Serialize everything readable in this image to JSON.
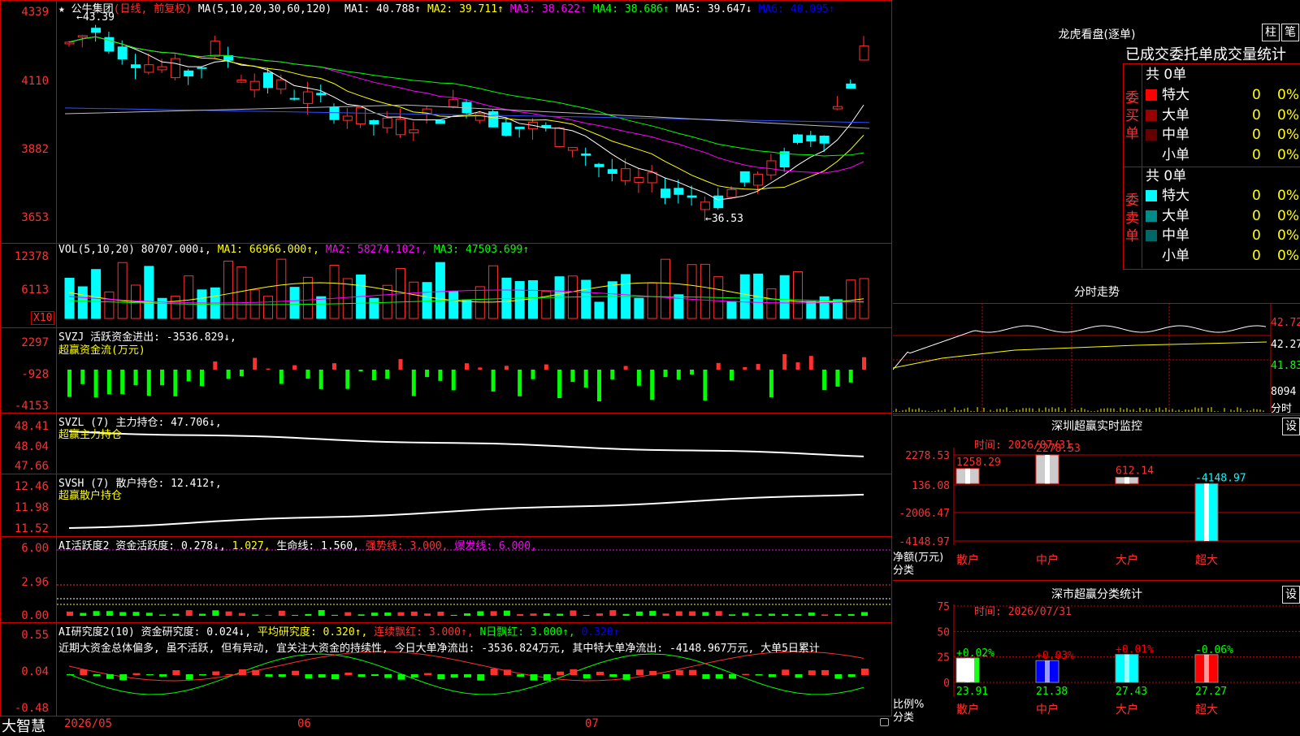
{
  "stock": {
    "star": "★",
    "name": "公牛集团",
    "period": "(日线, 前复权)"
  },
  "main_legend": {
    "ma_spec": "MA(5,10,20,30,60,120)",
    "items": [
      {
        "label": "MA1: 40.788↑",
        "color": "#ffffff"
      },
      {
        "label": "MA2: 39.711↑",
        "color": "#ffff00"
      },
      {
        "label": "MA3: 38.622↑",
        "color": "#ff00ff"
      },
      {
        "label": "MA4: 38.686↑",
        "color": "#00ff00"
      },
      {
        "label": "MA5: 39.647↓",
        "color": "#ffffff"
      },
      {
        "label": "MA6: 40.095↑",
        "color": "#0000ff"
      }
    ],
    "high_marker": "←43.39",
    "low_marker": "←36.53"
  },
  "main_axis": {
    "labels": [
      "4339",
      "4110",
      "3882",
      "3653"
    ]
  },
  "vol": {
    "legend": "VOL(5,10,20)",
    "value": "80707.000↓",
    "ma1": "MA1: 66966.000↑",
    "ma2": "MA2: 58274.102↑",
    "ma3": "MA3: 47503.699↑",
    "axis": [
      "12378",
      "6113"
    ],
    "unit": "X10"
  },
  "svzj": {
    "legend": "SVZJ  活跃资金进出: -3536.829↓,",
    "sub": "超赢资金流(万元)",
    "axis": [
      "2297",
      "-928",
      "-4153"
    ]
  },
  "svzl": {
    "legend": "SVZL (7) 主力持仓: 47.706↓,",
    "sub": "超赢主力持仓",
    "axis": [
      "48.41",
      "48.04",
      "47.66"
    ]
  },
  "svsh": {
    "legend": "SVSH (7) 散户持仓: 12.412↑,",
    "sub": "超赢散户持仓",
    "axis": [
      "12.46",
      "11.98",
      "11.52"
    ]
  },
  "ai_active": {
    "legend_a": "AI活跃度2 资金活跃度: 0.278↓,",
    "legend_b": "1.027,",
    "legend_c": "生命线: 1.560,",
    "legend_d": "强势线: 3.000,",
    "legend_e": "爆发线: 6.000,",
    "axis": [
      "6.00",
      "2.96",
      "0.00"
    ]
  },
  "ai_research": {
    "legend_a": "AI研究度2(10) 资金研究度: 0.024↓,",
    "legend_b": "平均研究度: 0.320↑,",
    "legend_c": "连续飘红: 3.000↑,",
    "legend_d": "N日飘红: 3.000↑,",
    "legend_e": "0.320↑",
    "comment": "近期大资金总体偏多, 虽不活跃, 但有异动, 宜关注大资金的持续性, 今日大单净流出: -3536.824万元, 其中特大单净流出: -4148.967万元, 大单5日累计",
    "axis": [
      "0.55",
      "0.04",
      "-0.48"
    ]
  },
  "x_axis": {
    "labels": [
      "2026/05",
      "06",
      "07"
    ]
  },
  "brand": "大智慧",
  "lhb": {
    "title": "龙虎看盘(逐单)",
    "btn_a": "柱",
    "btn_b": "笔",
    "header": "已成交委托单成交量统计",
    "buy_label": "委买单",
    "sell_label": "委卖单",
    "buy_total": "共 0单",
    "sell_total": "共 0单",
    "buy_rows": [
      {
        "name": "特大",
        "count": "0",
        "pct": "0%",
        "color": "#ff0000"
      },
      {
        "name": "大单",
        "count": "0",
        "pct": "0%",
        "color": "#990000"
      },
      {
        "name": "中单",
        "count": "0",
        "pct": "0%",
        "color": "#660000"
      },
      {
        "name": "小单",
        "count": "0",
        "pct": "0%",
        "color": "#000000"
      }
    ],
    "sell_rows": [
      {
        "name": "特大",
        "count": "0",
        "pct": "0%",
        "color": "#00ffff"
      },
      {
        "name": "大单",
        "count": "0",
        "pct": "0%",
        "color": "#008b8b"
      },
      {
        "name": "中单",
        "count": "0",
        "pct": "0%",
        "color": "#006666"
      },
      {
        "name": "小单",
        "count": "0",
        "pct": "0%",
        "color": "#000000"
      }
    ]
  },
  "intraday": {
    "title": "分时走势",
    "axis_right": [
      "42.72",
      "42.27",
      "41.83",
      "8094"
    ],
    "vol_caption": "分时"
  },
  "sz_monitor": {
    "title": "深圳超赢实时监控",
    "btn": "设",
    "time": "时间: 2026/07/31",
    "axis": [
      "2278.53",
      "136.08",
      "-2006.47",
      "-4148.97"
    ],
    "y_caption_a": "净额(万元)",
    "y_caption_b": "分类",
    "bars": [
      {
        "cat": "散户",
        "value": 1258.29,
        "label": "1258.29"
      },
      {
        "cat": "中户",
        "value": 2278.53,
        "label": "2278.53"
      },
      {
        "cat": "大户",
        "value": 612.14,
        "label": "612.14"
      },
      {
        "cat": "超大",
        "value": -4148.97,
        "label": "-4148.97"
      }
    ]
  },
  "sz_class": {
    "title": "深市超赢分类统计",
    "btn": "设",
    "time": "时间: 2026/07/31",
    "axis": [
      "75",
      "50",
      "25",
      "0"
    ],
    "y_caption_a": "比例%",
    "y_caption_b": "分类",
    "bars": [
      {
        "cat": "散户",
        "value": 23.91,
        "label": "23.91",
        "chg": "+0.02%",
        "color": "#ffffff",
        "chg_color": "#00ff00"
      },
      {
        "cat": "中户",
        "value": 21.38,
        "label": "21.38",
        "chg": "+0.03%",
        "color": "#0000ff",
        "chg_color": "#ff0000"
      },
      {
        "cat": "大户",
        "value": 27.43,
        "label": "27.43",
        "chg": "+0.01%",
        "color": "#00ffff",
        "chg_color": "#ff0000"
      },
      {
        "cat": "超大",
        "value": 27.27,
        "label": "27.27",
        "chg": "-0.06%",
        "color": "#ff0000",
        "chg_color": "#00ff00"
      }
    ]
  }
}
